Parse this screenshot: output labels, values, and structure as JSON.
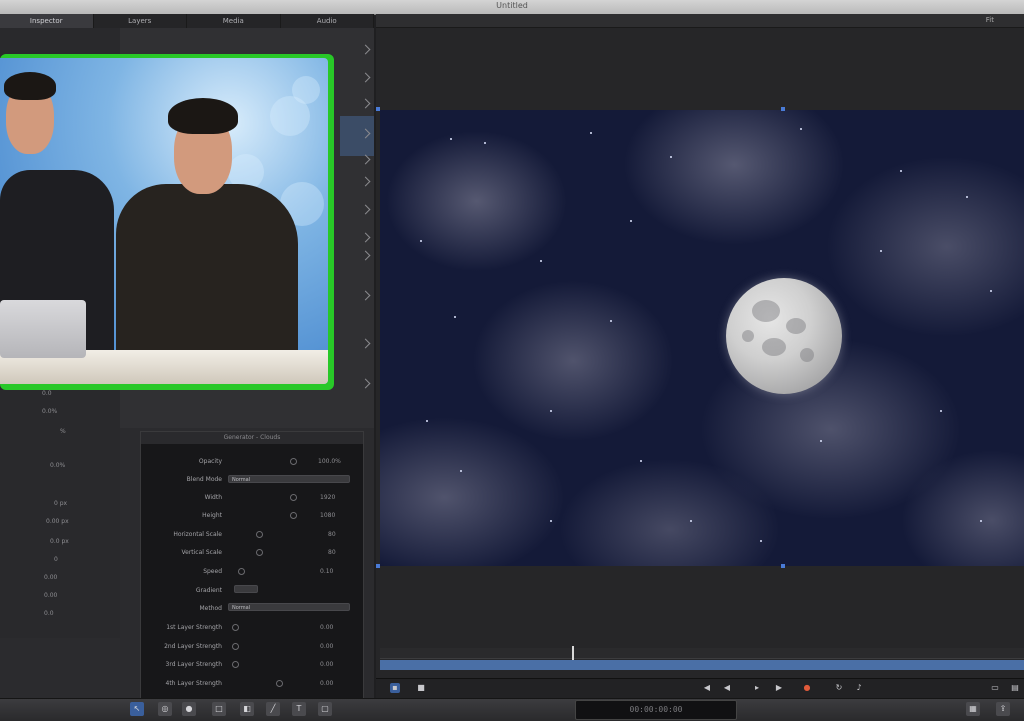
{
  "window": {
    "title": "Untitled"
  },
  "tabs": [
    {
      "label": "Inspector",
      "active": true
    },
    {
      "label": "Layers",
      "active": false
    },
    {
      "label": "Media",
      "active": false
    },
    {
      "label": "Audio",
      "active": false
    }
  ],
  "canvas": {
    "zoom": "Fit"
  },
  "left_values": [
    "0.0",
    "0.0%",
    "%",
    "0.0%",
    "0 px",
    "0.00 px",
    "0.0 px",
    "0",
    "0.00",
    "0.00",
    "0.0"
  ],
  "properties_panel": {
    "title": "Generator - Clouds",
    "rows": [
      {
        "label": "Opacity",
        "value": "100.0%"
      },
      {
        "label": "Blend Mode",
        "dropdown": "Normal"
      },
      {
        "label": "Width",
        "value": "1920"
      },
      {
        "label": "Height",
        "value": "1080"
      },
      {
        "label": "Horizontal Scale",
        "value": "80"
      },
      {
        "label": "Vertical Scale",
        "value": "80"
      },
      {
        "label": "Speed",
        "value": "0.10"
      },
      {
        "label": "Gradient",
        "dropdown": ""
      },
      {
        "label": "Method",
        "dropdown": "Normal"
      },
      {
        "label": "1st Layer Strength",
        "value": "0.00"
      },
      {
        "label": "2nd Layer Strength",
        "value": "0.00"
      },
      {
        "label": "3rd Layer Strength",
        "value": "0.00"
      },
      {
        "label": "4th Layer Strength",
        "value": "0.00"
      }
    ]
  },
  "timecode": "00:00:00:00",
  "icons": [
    "select-tool-icon",
    "pan-tool-icon",
    "shape-tool-icon",
    "text-tool-icon",
    "mask-tool-icon",
    "play-icon",
    "rewind-icon",
    "record-icon"
  ]
}
